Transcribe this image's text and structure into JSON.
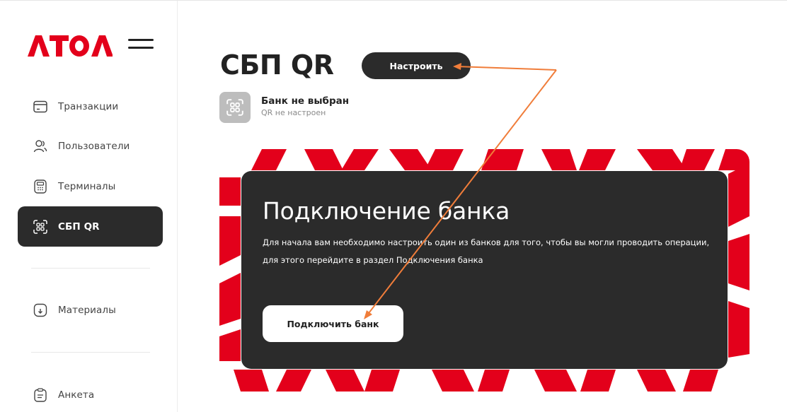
{
  "brand": {
    "logo_text": "ATOL",
    "accent": "#e3001b",
    "dark": "#2b2b2b"
  },
  "sidebar": {
    "menu_icon": "hamburger-menu-icon",
    "items": [
      {
        "label": "Транзакции",
        "icon": "card-icon",
        "active": false
      },
      {
        "label": "Пользователи",
        "icon": "users-icon",
        "active": false
      },
      {
        "label": "Терминалы",
        "icon": "terminal-icon",
        "active": false
      },
      {
        "label": "СБП QR",
        "icon": "qr-icon",
        "active": true
      },
      {
        "label": "Материалы",
        "icon": "download-doc-icon",
        "active": false
      },
      {
        "label": "Анкета",
        "icon": "form-icon",
        "active": false
      }
    ]
  },
  "header": {
    "title": "СБП QR",
    "setup_button": "Настроить"
  },
  "bank": {
    "name": "Банк не выбран",
    "status": "QR не настроен",
    "icon": "qr-icon"
  },
  "banner": {
    "title": "Подключение банка",
    "text": "Для начала вам необходимо настроить один из банков для того, чтобы вы могли проводить операции, для этого перейдите в раздел Подключения банка",
    "button": "Подключить банк",
    "pattern_text": "ATOL"
  },
  "annotation": {
    "arrow_color": "#f07d3a"
  }
}
